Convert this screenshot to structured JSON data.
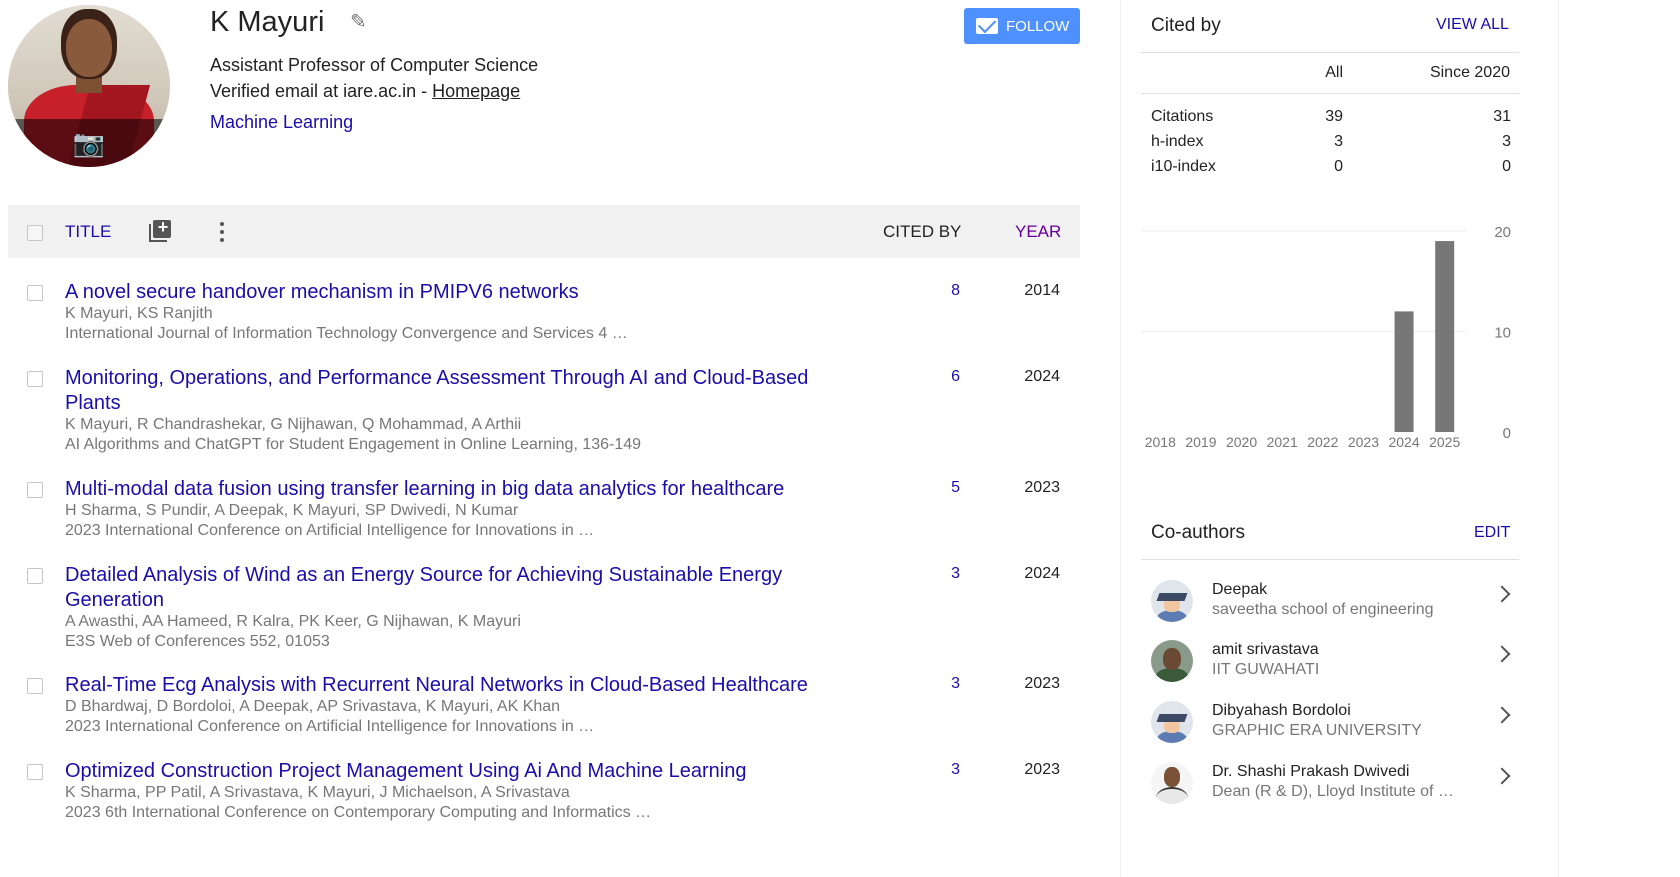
{
  "profile": {
    "name": "K Mayuri",
    "affiliation": "Assistant Professor of Computer Science",
    "email_text": "Verified email at iare.ac.in - ",
    "homepage_label": "Homepage",
    "interest": "Machine Learning",
    "follow_label": "FOLLOW",
    "icons": {
      "edit": "pencil-icon",
      "photo": "add-photo-icon",
      "follow": "mail-icon"
    }
  },
  "table": {
    "header": {
      "title": "TITLE",
      "cited_by": "CITED BY",
      "year": "YEAR"
    },
    "articles": [
      {
        "title": "A novel secure handover mechanism in PMIPV6 networks",
        "authors": "K Mayuri, KS Ranjith",
        "venue": "International Journal of Information Technology Convergence and Services 4 …",
        "cited_by": "8",
        "year": "2014"
      },
      {
        "title": "Monitoring, Operations, and Performance Assessment Through AI and Cloud-Based Plants",
        "authors": "K Mayuri, R Chandrashekar, G Nijhawan, Q Mohammad, A Arthii",
        "venue": "AI Algorithms and ChatGPT for Student Engagement in Online Learning, 136-149",
        "cited_by": "6",
        "year": "2024"
      },
      {
        "title": "Multi-modal data fusion using transfer learning in big data analytics for healthcare",
        "authors": "H Sharma, S Pundir, A Deepak, K Mayuri, SP Dwivedi, N Kumar",
        "venue": "2023 International Conference on Artificial Intelligence for Innovations in …",
        "cited_by": "5",
        "year": "2023"
      },
      {
        "title": "Detailed Analysis of Wind as an Energy Source for Achieving Sustainable Energy Generation",
        "authors": "A Awasthi, AA Hameed, R Kalra, PK Keer, G Nijhawan, K Mayuri",
        "venue": "E3S Web of Conferences 552, 01053",
        "cited_by": "3",
        "year": "2024"
      },
      {
        "title": "Real-Time Ecg Analysis with Recurrent Neural Networks in Cloud-Based Healthcare",
        "authors": "D Bhardwaj, D Bordoloi, A Deepak, AP Srivastava, K Mayuri, AK Khan",
        "venue": "2023 International Conference on Artificial Intelligence for Innovations in …",
        "cited_by": "3",
        "year": "2023"
      },
      {
        "title": "Optimized Construction Project Management Using Ai And Machine Learning",
        "authors": "K Sharma, PP Patil, A Srivastava, K Mayuri, J Michaelson, A Srivastava",
        "venue": "2023 6th International Conference on Contemporary Computing and Informatics …",
        "cited_by": "3",
        "year": "2023"
      }
    ]
  },
  "cited_by": {
    "title": "Cited by",
    "view_all": "VIEW ALL",
    "columns": {
      "all": "All",
      "since": "Since 2020"
    },
    "metrics": [
      {
        "label": "Citations",
        "all": "39",
        "since": "31"
      },
      {
        "label": "h-index",
        "all": "3",
        "since": "3"
      },
      {
        "label": "i10-index",
        "all": "0",
        "since": "0"
      }
    ]
  },
  "chart_data": {
    "type": "bar",
    "categories": [
      "2018",
      "2019",
      "2020",
      "2021",
      "2022",
      "2023",
      "2024",
      "2025"
    ],
    "values": [
      0,
      0,
      0,
      0,
      0,
      0,
      12,
      19
    ],
    "y_ticks": [
      0,
      10,
      20
    ],
    "ylim": [
      0,
      20
    ],
    "grid": true,
    "bar_color": "#777777"
  },
  "coauthors": {
    "title": "Co-authors",
    "edit_label": "EDIT",
    "items": [
      {
        "name": "Deepak",
        "affiliation": "saveetha school of engineering",
        "avatar": "graduate-avatar-icon"
      },
      {
        "name": "amit srivastava",
        "affiliation": "IIT GUWAHATI",
        "avatar": "photo-avatar"
      },
      {
        "name": "Dibyahash Bordoloi",
        "affiliation": "GRAPHIC ERA UNIVERSITY",
        "avatar": "graduate-avatar-icon"
      },
      {
        "name": "Dr. Shashi Prakash Dwivedi",
        "affiliation": "Dean (R & D), Lloyd Institute of …",
        "avatar": "photo-avatar"
      }
    ]
  },
  "colors": {
    "link": "#1a0dab",
    "muted": "#777777",
    "accent": "#4d90fe",
    "year_header": "#660099"
  }
}
